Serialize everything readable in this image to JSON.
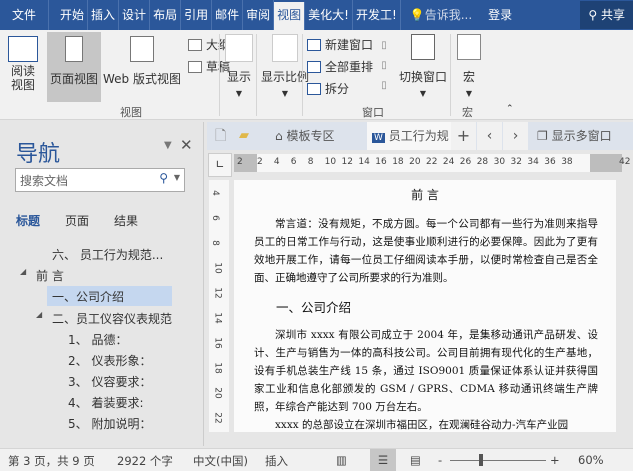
{
  "tabs": [
    "文件",
    "开始",
    "插入",
    "设计",
    "布局",
    "引用",
    "邮件",
    "审阅",
    "视图",
    "美化大!",
    "开发工!"
  ],
  "active_tab": "视图",
  "tell_me": "告诉我...",
  "login": "登录",
  "share": "共享",
  "ribbon": {
    "read_view": "阅读视图",
    "page_view": "页面视图",
    "web_view": "Web 版式视图",
    "outline": "大纲视图",
    "draft": "草稿",
    "group_view": "视图",
    "show": "显示",
    "zoom": "显示比例",
    "new_window": "新建窗口",
    "arrange_all": "全部重排",
    "split": "拆分",
    "switch_window": "切换窗口",
    "group_window": "窗口",
    "macro": "宏",
    "group_macro": "宏"
  },
  "nav": {
    "title": "导航",
    "search_placeholder": "搜索文档",
    "tabs": [
      "标题",
      "页面",
      "结果"
    ],
    "tree": [
      {
        "label": "六、 员工行为规范...",
        "level": 2
      },
      {
        "label": "前 言",
        "level": 1,
        "expanded": true
      },
      {
        "label": "一、公司介绍",
        "level": 2,
        "selected": true
      },
      {
        "label": "二、员工仪容仪表规范",
        "level": 2,
        "expanded": true
      },
      {
        "label": "1、  品德：",
        "level": 3
      },
      {
        "label": "2、  仪表形象：",
        "level": 3
      },
      {
        "label": "3、  仪容要求：",
        "level": 3
      },
      {
        "label": "4、  着装要求:",
        "level": 3
      },
      {
        "label": "5、  附加说明：",
        "level": 3
      }
    ]
  },
  "doc_tabs": {
    "template": "模板专区",
    "document": "员工行为规",
    "multi_window": "显示多窗口"
  },
  "ruler": {
    "h": [
      "2",
      "2",
      "4",
      "6",
      "8",
      "10",
      "12",
      "14",
      "16",
      "18",
      "20",
      "22",
      "24",
      "26",
      "28",
      "30",
      "32",
      "34",
      "36",
      "38",
      "42"
    ],
    "v": [
      "4",
      "6",
      "8",
      "10",
      "12",
      "14",
      "16",
      "18",
      "20",
      "22"
    ]
  },
  "document": {
    "heading": "前 言",
    "p1": "常言道：没有规矩，不成方圆。每一个公司都有一些行为准则来指导员工的日常工作与行动，这是使事业顺利进行的必要保障。因此为了更有效地开展工作，请每一位员工仔细阅读本手册，以便时常检查自己是否全面、正确地遵守了公司所要求的行为准则。",
    "h2": "一、公司介绍",
    "p2": "深圳市 xxxx 有限公司成立于 2004 年，是集移动通讯产品研发、设计、生产与销售为一体的高科技公司。公司目前拥有现代化的生产基地，设有手机总装生产线 15 条，通过 ISO9001 质量保证体系认证并获得国家工业和信息化部颁发的 GSM / GPRS、CDMA 移动通讯终端生产牌照，年综合产能达到 700 万台左右。",
    "p3": "xxxx 的总部设立在深圳市福田区，在观澜硅谷动力-汽车产业园"
  },
  "status": {
    "page": "第 3 页，共 9 页",
    "words": "2922 个字",
    "language": "中文(中国)",
    "mode": "插入",
    "zoom": "60%",
    "zoom_value": 60
  }
}
